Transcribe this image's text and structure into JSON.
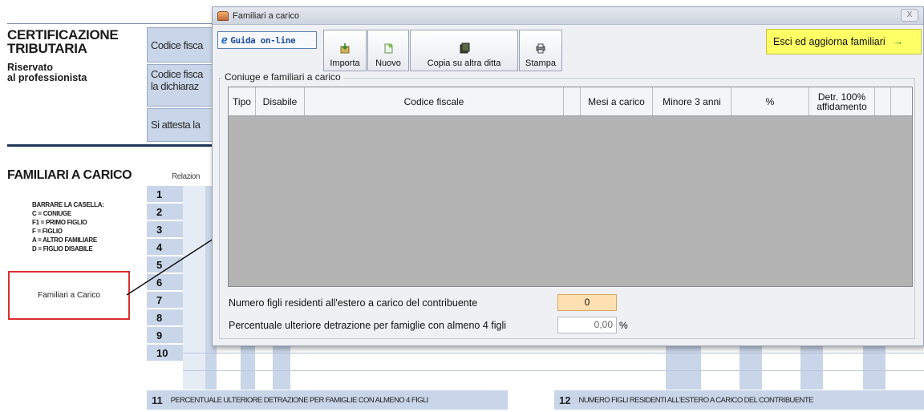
{
  "background": {
    "title": "CERTIFICAZIONE\nTRIBUTARIA",
    "subtitle": "Riservato\nal professionista",
    "fields": [
      "Codice fisca",
      "Codice fisca\nla dichiaraz",
      "Si attesta la"
    ],
    "familiari_title": "FAMILIARI A CARICO",
    "legend": [
      "BARRARE LA CASELLA:",
      "C  =  CONIUGE",
      "F1 =  PRIMO FIGLIO",
      "F  =  FIGLIO",
      "A  =  ALTRO FAMILIARE",
      "D  =  FIGLIO DISABILE"
    ],
    "relazione_label": "Relazion",
    "row_numbers": [
      "1",
      "2",
      "3",
      "4",
      "5",
      "6",
      "7",
      "8",
      "9",
      "10"
    ],
    "red_box_label": "Familiari a Carico",
    "bottom_11_num": "11",
    "bottom_11_text": "PERCENTUALE ULTERIORE DETRAZIONE PER FAMIGLIE CON ALMENO 4 FIGLI",
    "bottom_12_num": "12",
    "bottom_12_text": "NUMERO FIGLI RESIDENTI ALL'ESTERO A CARICO DEL CONTRIBUENTE"
  },
  "dialog": {
    "title": "Familiari a carico",
    "close_label": "X",
    "guida_label": "Guida on-line",
    "toolbar": {
      "importa": "Importa",
      "nuovo": "Nuovo",
      "copia": "Copia su altra ditta",
      "stampa": "Stampa"
    },
    "exit_label": "Esci ed aggiorna familiari",
    "group_label": "Coniuge e familiari a carico",
    "columns": [
      "Tipo",
      "Disabile",
      "Codice fiscale",
      "",
      "Mesi a carico",
      "Minore 3 anni",
      "%",
      "Detr. 100%\naffidamento",
      ""
    ],
    "numero_figli_label": "Numero figli residenti all'estero a carico del contribuente",
    "numero_figli_value": "0",
    "percentuale_label": "Percentuale ulteriore detrazione per famiglie con almeno 4 figli",
    "percentuale_value": "0,00",
    "percentuale_unit": "%"
  }
}
